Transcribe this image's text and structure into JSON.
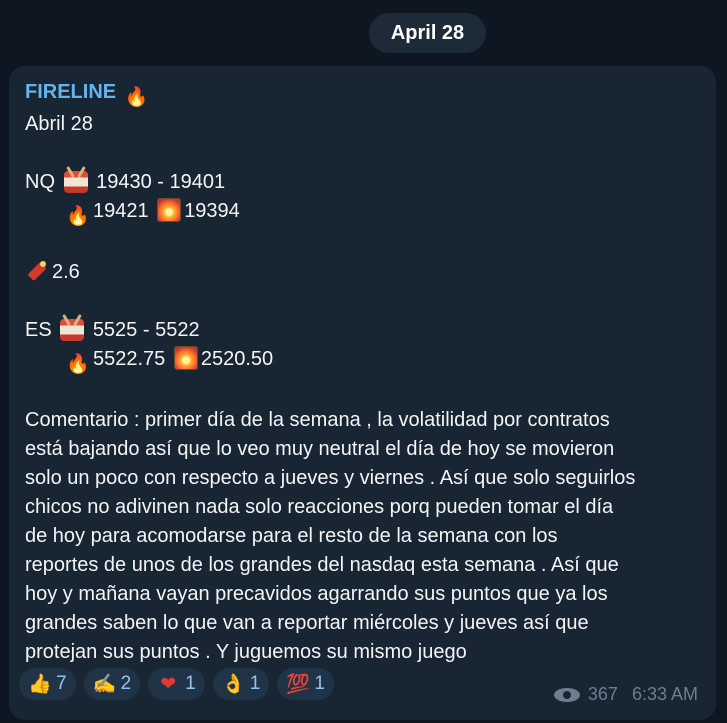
{
  "date_pill": "April 28",
  "message": {
    "sender": "FIRELINE",
    "date_line": "Abril 28",
    "nq_label": "NQ",
    "nq_range": "19430 - 19401",
    "nq_fire": "19421",
    "nq_burst": "19394",
    "dynamite_value": "2.6",
    "es_label": "ES",
    "es_range": "5525 - 5522",
    "es_fire": "5522.75",
    "es_burst": "2520.50",
    "comment_lines": [
      "Comentario :  primer día de la semana , la volatilidad por contratos",
      "está bajando así que lo veo muy neutral el día de hoy se movieron",
      "solo un poco con respecto a jueves y viernes . Así que solo seguirlos",
      "chicos no adivinen nada solo reacciones porq pueden tomar el día",
      "de hoy para acomodarse para el resto de la semana con los",
      "reportes de unos de los  grandes del nasdaq esta semana . Así que",
      "hoy y mañana vayan precavidos agarrando sus puntos que ya los",
      "grandes saben lo que van a reportar miércoles y jueves así que",
      "protejan sus puntos . Y juguemos su mismo juego"
    ]
  },
  "reactions": [
    {
      "icon": "thumbs-up-icon",
      "glyph": "👍",
      "count": "7"
    },
    {
      "icon": "writing-hand-icon",
      "glyph": "✍",
      "count": "2"
    },
    {
      "icon": "heart-icon",
      "glyph": "❤",
      "count": "1"
    },
    {
      "icon": "ok-hand-icon",
      "glyph": "👌",
      "count": "1"
    },
    {
      "icon": "hundred-points-icon",
      "glyph": "💯",
      "count": "1"
    }
  ],
  "views": "367",
  "time": "6:33 AM",
  "colors": {
    "accent": "#64b5ef",
    "bubble": "#182533",
    "background": "#0e1621"
  }
}
